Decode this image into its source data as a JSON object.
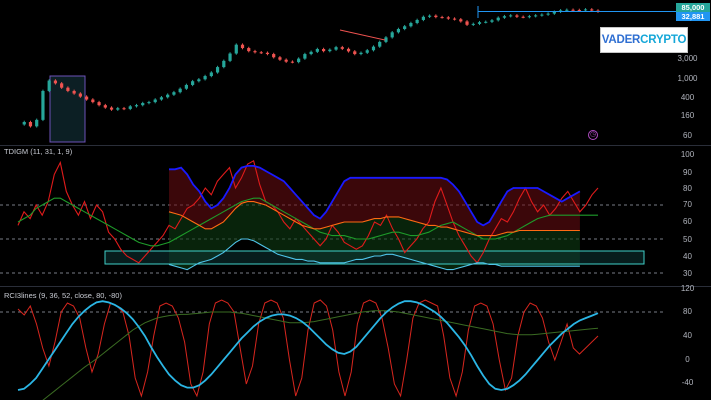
{
  "logo": {
    "part1": "VADER",
    "part2": "CRYPTO"
  },
  "price_pane": {
    "tags": {
      "current": "85,000",
      "level": "32,881"
    },
    "colors": {
      "up": "#26a69a",
      "down": "#ef5350",
      "current_tag": "#26a69a",
      "level_tag": "#2196f3"
    }
  },
  "tdigm": {
    "label": "TDIGM (11, 31, 1, 9)"
  },
  "rci": {
    "label": "RCI3lines (9, 36, 52, close, 80, -80)"
  },
  "chart_data": [
    {
      "type": "line",
      "pane": "price",
      "scale": "log",
      "y_ticks": [
        "3,000",
        "1,000",
        "400",
        "160",
        "60"
      ],
      "close": [
        95,
        110,
        85,
        125,
        700,
        1300,
        1100,
        850,
        700,
        600,
        500,
        420,
        360,
        300,
        260,
        230,
        250,
        240,
        280,
        300,
        340,
        360,
        420,
        480,
        560,
        650,
        800,
        1000,
        1250,
        1400,
        1700,
        2100,
        2900,
        4200,
        6500,
        11000,
        9000,
        7500,
        7000,
        6800,
        6300,
        5200,
        4500,
        4000,
        3900,
        4800,
        6300,
        7200,
        8500,
        7500,
        8200,
        9500,
        8600,
        7400,
        6300,
        6800,
        7900,
        9800,
        13000,
        17000,
        23000,
        28000,
        33000,
        40000,
        48000,
        58000,
        62000,
        57000,
        56000,
        52000,
        50000,
        44000,
        36000,
        38000,
        42000,
        43000,
        47000,
        55000,
        60000,
        63000,
        58000,
        57000,
        60000,
        63000,
        66000,
        70000,
        78000,
        85000,
        88000,
        87000,
        85000,
        90000,
        84000,
        79000
      ]
    },
    {
      "type": "line",
      "pane": "TDIGM",
      "ylim": [
        25,
        105
      ],
      "y_ticks": [
        100,
        90,
        80,
        70,
        60,
        50,
        40,
        30
      ],
      "levels": [
        70,
        50,
        30
      ],
      "series": [
        {
          "name": "",
          "color": "#e01b1b",
          "values": [
            58,
            66,
            62,
            70,
            64,
            72,
            88,
            95,
            78,
            70,
            64,
            72,
            62,
            70,
            66,
            54,
            50,
            44,
            40,
            38,
            36,
            40,
            44,
            48,
            52,
            58,
            56,
            62,
            68,
            70,
            74,
            80,
            76,
            84,
            88,
            92,
            80,
            86,
            94,
            96,
            82,
            72,
            70,
            66,
            60,
            56,
            62,
            58,
            54,
            50,
            46,
            50,
            58,
            54,
            48,
            46,
            44,
            46,
            52,
            60,
            58,
            64,
            56,
            50,
            42,
            46,
            50,
            56,
            60,
            72,
            80,
            70,
            60,
            52,
            46,
            40,
            36,
            42,
            50,
            56,
            62,
            60,
            66,
            74,
            80,
            72,
            66,
            70,
            64,
            68,
            74,
            78,
            72,
            66,
            70,
            76,
            80
          ]
        },
        {
          "name": "",
          "color": "#1e9c2a",
          "values": [
            60,
            62,
            64,
            68,
            70,
            72,
            74,
            74,
            72,
            70,
            68,
            66,
            64,
            62,
            60,
            58,
            56,
            54,
            52,
            50,
            48,
            47,
            46,
            46,
            47,
            48,
            50,
            52,
            54,
            56,
            58,
            60,
            62,
            64,
            66,
            68,
            70,
            72,
            73,
            74,
            74,
            72,
            70,
            68,
            66,
            64,
            62,
            60,
            58,
            56,
            54,
            53,
            52,
            52,
            52,
            51,
            50,
            50,
            50,
            51,
            52,
            53,
            54,
            54,
            53,
            52,
            52,
            53,
            54,
            56,
            58,
            59,
            60,
            58,
            56,
            54,
            52,
            50,
            50,
            50,
            51,
            52,
            54,
            56,
            58,
            60,
            62,
            63,
            64,
            64,
            64,
            64,
            64,
            64,
            64,
            64,
            64
          ]
        },
        {
          "name": "",
          "color": "#1a1aff",
          "values": [
            null,
            null,
            null,
            null,
            null,
            null,
            null,
            null,
            null,
            null,
            null,
            null,
            null,
            null,
            null,
            null,
            null,
            null,
            null,
            null,
            null,
            null,
            null,
            null,
            null,
            91,
            91,
            92,
            88,
            82,
            78,
            72,
            68,
            70,
            74,
            80,
            88,
            92,
            93,
            93,
            92,
            90,
            88,
            86,
            84,
            80,
            76,
            72,
            68,
            64,
            62,
            66,
            72,
            78,
            84,
            86,
            86,
            86,
            86,
            86,
            86,
            86,
            86,
            86,
            86,
            86,
            86,
            86,
            86,
            86,
            86,
            85,
            82,
            78,
            72,
            66,
            60,
            58,
            60,
            66,
            72,
            78,
            80,
            80,
            80,
            80,
            80,
            78,
            76,
            74,
            72,
            74,
            76,
            78,
            null,
            null,
            null
          ]
        },
        {
          "name": "",
          "color": "#ff6a13",
          "values": [
            null,
            null,
            null,
            null,
            null,
            null,
            null,
            null,
            null,
            null,
            null,
            null,
            null,
            null,
            null,
            null,
            null,
            null,
            null,
            null,
            null,
            null,
            null,
            null,
            null,
            66,
            65,
            64,
            62,
            60,
            58,
            56,
            56,
            58,
            60,
            64,
            68,
            71,
            72,
            72,
            71,
            70,
            68,
            66,
            64,
            62,
            60,
            58,
            57,
            56,
            56,
            57,
            58,
            59,
            60,
            60,
            60,
            60,
            61,
            62,
            62,
            63,
            63,
            63,
            62,
            61,
            60,
            59,
            58,
            58,
            57,
            57,
            56,
            55,
            54,
            53,
            52,
            52,
            52,
            52,
            53,
            54,
            54,
            55,
            55,
            55,
            55,
            55,
            55,
            55,
            55,
            55,
            55,
            55,
            null,
            null,
            null
          ]
        },
        {
          "name": "",
          "color": "#4fc3e8",
          "values": [
            null,
            null,
            null,
            null,
            null,
            null,
            null,
            null,
            null,
            null,
            null,
            null,
            null,
            null,
            null,
            null,
            null,
            null,
            null,
            null,
            null,
            null,
            null,
            null,
            null,
            35,
            34,
            33,
            32,
            34,
            36,
            37,
            38,
            40,
            42,
            45,
            48,
            50,
            50,
            49,
            47,
            45,
            43,
            41,
            40,
            39,
            38,
            38,
            37,
            37,
            36,
            36,
            36,
            36,
            36,
            37,
            38,
            38,
            39,
            40,
            40,
            41,
            41,
            40,
            39,
            38,
            37,
            36,
            35,
            34,
            33,
            32,
            32,
            33,
            34,
            35,
            36,
            36,
            35,
            35,
            34,
            34,
            34,
            34,
            34,
            34,
            34,
            34,
            34,
            34,
            34,
            34,
            34,
            34,
            null,
            null,
            null
          ]
        }
      ]
    },
    {
      "type": "line",
      "pane": "RCI3lines",
      "ylim": [
        -50,
        120
      ],
      "y_ticks": [
        120,
        80,
        40,
        0,
        -40
      ],
      "levels": [
        80,
        -80
      ],
      "series": [
        {
          "name": "",
          "color": "#d7261e",
          "values": [
            85,
            75,
            90,
            60,
            20,
            -10,
            30,
            80,
            95,
            90,
            70,
            20,
            -20,
            10,
            60,
            95,
            90,
            80,
            40,
            -30,
            -60,
            -20,
            40,
            90,
            95,
            90,
            70,
            30,
            -40,
            -60,
            -20,
            60,
            95,
            100,
            95,
            80,
            20,
            -40,
            -10,
            60,
            95,
            100,
            95,
            70,
            0,
            -60,
            -30,
            50,
            95,
            100,
            90,
            50,
            -20,
            -60,
            -20,
            60,
            95,
            100,
            95,
            70,
            20,
            -40,
            -60,
            0,
            70,
            95,
            100,
            95,
            90,
            40,
            -30,
            -60,
            -20,
            50,
            90,
            95,
            90,
            60,
            0,
            -50,
            -30,
            40,
            80,
            95,
            90,
            70,
            30,
            0,
            30,
            60,
            20,
            10,
            20,
            30,
            40
          ]
        },
        {
          "name": "",
          "color": "#3a6b22",
          "values": [
            -90,
            -85,
            -80,
            -75,
            -68,
            -60,
            -52,
            -44,
            -36,
            -28,
            -20,
            -12,
            -5,
            2,
            10,
            18,
            26,
            34,
            42,
            50,
            56,
            62,
            66,
            70,
            72,
            74,
            75,
            76,
            76,
            77,
            78,
            79,
            80,
            80,
            80,
            80,
            79,
            78,
            76,
            74,
            72,
            70,
            68,
            66,
            64,
            62,
            62,
            62,
            63,
            64,
            66,
            68,
            70,
            72,
            74,
            76,
            78,
            80,
            81,
            82,
            82,
            82,
            81,
            80,
            78,
            76,
            74,
            72,
            70,
            68,
            66,
            64,
            62,
            60,
            58,
            56,
            54,
            52,
            50,
            48,
            46,
            44,
            43,
            42,
            42,
            42,
            43,
            44,
            45,
            46,
            47,
            48,
            49,
            50,
            51,
            52,
            53
          ]
        },
        {
          "name": "",
          "color": "#2bb6e5",
          "values": [
            -50,
            -48,
            -40,
            -30,
            -15,
            0,
            15,
            30,
            45,
            60,
            72,
            82,
            90,
            96,
            98,
            96,
            92,
            86,
            78,
            68,
            55,
            40,
            22,
            5,
            -10,
            -24,
            -34,
            -42,
            -46,
            -46,
            -42,
            -34,
            -24,
            -12,
            0,
            12,
            24,
            36,
            46,
            56,
            64,
            70,
            74,
            76,
            76,
            74,
            70,
            64,
            56,
            46,
            36,
            26,
            18,
            12,
            10,
            14,
            22,
            34,
            46,
            58,
            70,
            80,
            88,
            94,
            98,
            98,
            96,
            92,
            86,
            80,
            72,
            62,
            50,
            38,
            24,
            8,
            -10,
            -26,
            -40,
            -48,
            -50,
            -48,
            -42,
            -34,
            -24,
            -12,
            0,
            12,
            24,
            34,
            44,
            52,
            60,
            66,
            70,
            74,
            78
          ]
        }
      ]
    }
  ]
}
